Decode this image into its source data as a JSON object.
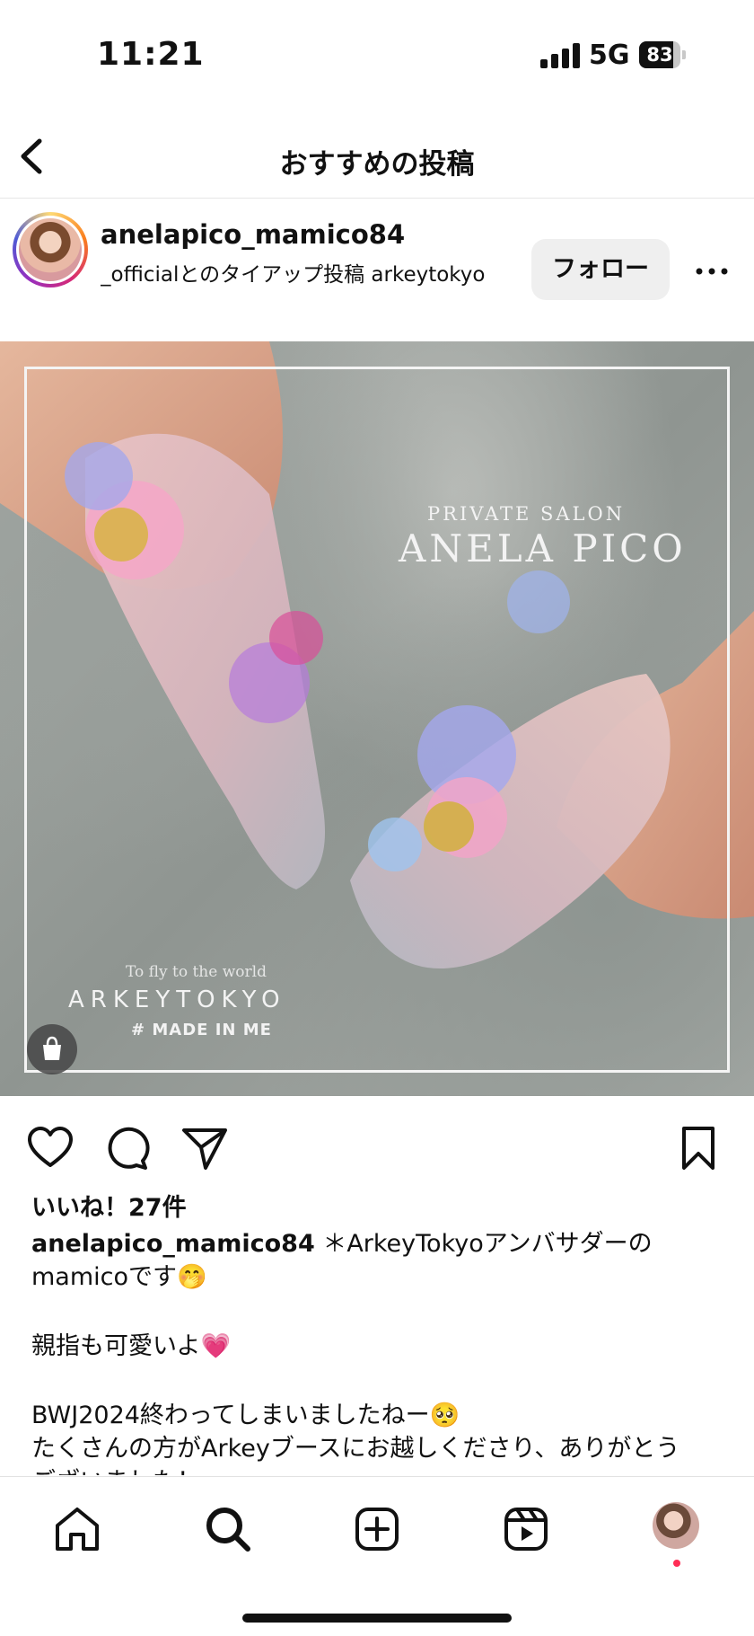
{
  "status_bar": {
    "time": "11:21",
    "network": "5G",
    "battery": "83",
    "battery_level_percent": 83
  },
  "nav": {
    "title": "おすすめの投稿",
    "back_icon": "chevron-left-icon"
  },
  "post": {
    "username": "anelapico_mamico84",
    "subline": "_officialとのタイアップ投稿  arkeytokyo",
    "follow_label": "フォロー",
    "more_icon": "ellipsis-icon",
    "image": {
      "watermark_top_line1": "PRIVATE SALON",
      "watermark_top_line2": "ANELA PICO",
      "watermark_bottom_line1": "To fly to the world",
      "watermark_bottom_line2": "ARKEYTOKYO",
      "watermark_bottom_line3": "# MADE IN ME",
      "shop_icon": "shopping-bag-icon"
    },
    "actions": {
      "like_icon": "heart-icon",
      "comment_icon": "comment-icon",
      "share_icon": "paper-plane-icon",
      "save_icon": "bookmark-icon"
    },
    "likes": "いいね！27件",
    "caption": {
      "username": "anelapico_mamico84",
      "line1": " ＊ArkeyTokyoアンバサダーの",
      "line2": "mamicoです🤭",
      "line3": "親指も可愛いよ💗",
      "line4": "BWJ2024終わってしまいましたねー🥺",
      "line5": "たくさんの方がArkeyブースにお越しくださり、ありがとう",
      "line6": "ございました！"
    }
  },
  "tabbar": {
    "home_icon": "home-icon",
    "search_icon": "search-icon",
    "create_icon": "plus-square-icon",
    "reels_icon": "reels-icon",
    "profile_icon": "profile-avatar-icon"
  },
  "colors": {
    "follow_bg": "#efefef",
    "notif_dot": "#ff2d55",
    "text": "#111111"
  }
}
